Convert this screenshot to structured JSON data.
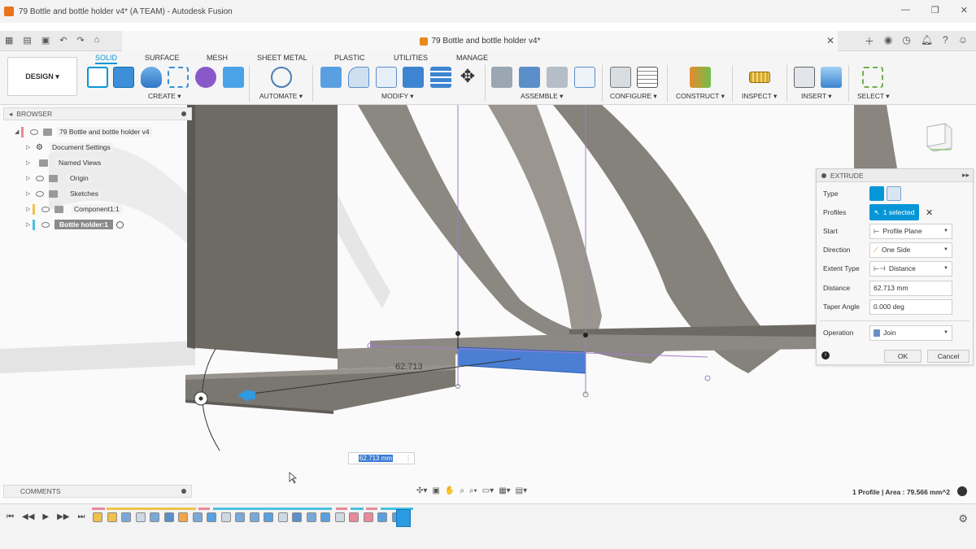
{
  "window": {
    "title": "79 Bottle and bottle holder v4* (A TEAM) - Autodesk Fusion"
  },
  "document_tab": {
    "title": "79 Bottle and bottle holder v4*"
  },
  "ribbon": {
    "workspace": "DESIGN ▾",
    "tabs": [
      "SOLID",
      "SURFACE",
      "MESH",
      "SHEET METAL",
      "PLASTIC",
      "UTILITIES",
      "MANAGE"
    ],
    "groups": [
      "CREATE ▾",
      "AUTOMATE ▾",
      "MODIFY ▾",
      "ASSEMBLE ▾",
      "CONFIGURE ▾",
      "CONSTRUCT ▾",
      "INSPECT ▾",
      "INSERT ▾",
      "SELECT ▾"
    ]
  },
  "browser": {
    "header": "BROWSER",
    "items": [
      {
        "label": "79 Bottle and bottle holder v4"
      },
      {
        "label": "Document Settings"
      },
      {
        "label": "Named Views"
      },
      {
        "label": "Origin"
      },
      {
        "label": "Sketches"
      },
      {
        "label": "Component1:1"
      },
      {
        "label": "Bottle holder:1"
      }
    ]
  },
  "extrude": {
    "header": "EXTRUDE",
    "type_label": "Type",
    "profiles_label": "Profiles",
    "profiles_value": "1 selected",
    "start_label": "Start",
    "start_value": "Profile Plane",
    "direction_label": "Direction",
    "direction_value": "One Side",
    "extent_label": "Extent Type",
    "extent_value": "Distance",
    "distance_label": "Distance",
    "distance_value": "62.713 mm",
    "taper_label": "Taper Angle",
    "taper_value": "0.000 deg",
    "operation_label": "Operation",
    "operation_value": "Join",
    "ok_label": "OK",
    "cancel_label": "Cancel"
  },
  "viewport": {
    "dimension_label": "62.713",
    "dimension_input": "62.713 mm"
  },
  "comments": {
    "label": "COMMENTS"
  },
  "status": {
    "text": "1 Profile | Area : 79.566 mm^2"
  },
  "colors": {
    "accent": "#0696d7",
    "selection_face": "#4a7fd4",
    "body_gray": "#7a7670"
  }
}
